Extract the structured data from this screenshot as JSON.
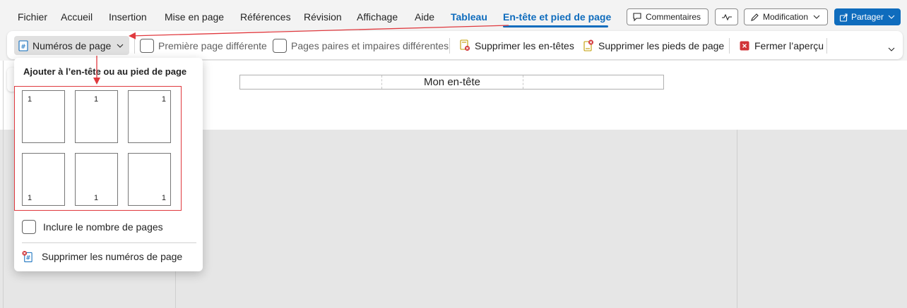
{
  "menu": {
    "tabs": [
      {
        "label": "Fichier"
      },
      {
        "label": "Accueil"
      },
      {
        "label": "Insertion"
      },
      {
        "label": "Mise en page"
      },
      {
        "label": "Références"
      },
      {
        "label": "Révision"
      },
      {
        "label": "Affichage"
      },
      {
        "label": "Aide"
      },
      {
        "label": "Tableau"
      },
      {
        "label": "En-tête et pied de page"
      }
    ],
    "comments_label": "Commentaires",
    "editing_label": "Modification",
    "share_label": "Partager"
  },
  "ribbon": {
    "page_numbers_label": "Numéros de page",
    "first_page_label": "Première page différente",
    "odd_even_label": "Pages paires et impaires différentes",
    "remove_headers_label": "Supprimer les en-têtes",
    "remove_footers_label": "Supprimer les pieds de page",
    "close_preview_label": "Fermer l’aperçu"
  },
  "document": {
    "header_text": "Mon en-tête"
  },
  "dropdown": {
    "title": "Ajouter à l’en-tête ou au pied de page",
    "thumbnail_number": "1",
    "include_count_label": "Inclure le nombre de pages",
    "remove_numbers_label": "Supprimer les numéros de page"
  },
  "colors": {
    "accent": "#0f6cbd",
    "annotation": "#e0393e",
    "close_icon": "#d13438"
  }
}
